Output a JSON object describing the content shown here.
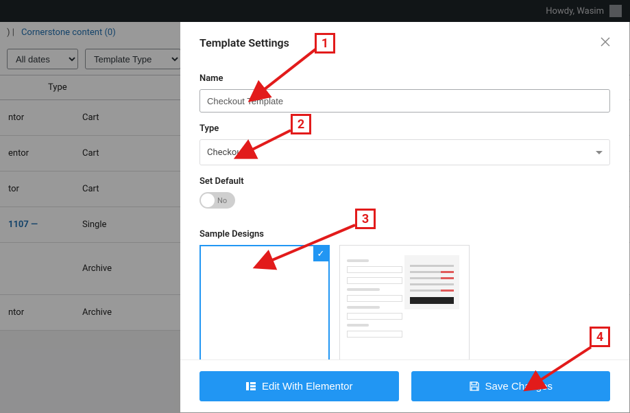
{
  "topbar": {
    "greeting": "Howdy, Wasim"
  },
  "filters": {
    "cornerstone": "Cornerstone content",
    "cornerstone_count": "(0)",
    "dates": "All dates",
    "template_type": "Template Type"
  },
  "list": {
    "col_type": "Type",
    "rows": [
      {
        "editor": "ntor",
        "type": "Cart"
      },
      {
        "editor": "entor",
        "type": "Cart"
      },
      {
        "editor": "tor",
        "type": "Cart"
      },
      {
        "editor": "1107 —",
        "type": "Single",
        "islink": true
      },
      {
        "editor": "",
        "type": "Archive"
      },
      {
        "editor": "ntor",
        "type": "Archive"
      }
    ]
  },
  "modal": {
    "title": "Template Settings",
    "name_label": "Name",
    "name_value": "Checkout Template",
    "type_label": "Type",
    "type_value": "Checkout",
    "default_label": "Set Default",
    "default_state": "No",
    "designs_label": "Sample Designs"
  },
  "footer": {
    "edit": "Edit With Elementor",
    "save": "Save Changes"
  },
  "anno": {
    "n1": "1",
    "n2": "2",
    "n3": "3",
    "n4": "4"
  }
}
